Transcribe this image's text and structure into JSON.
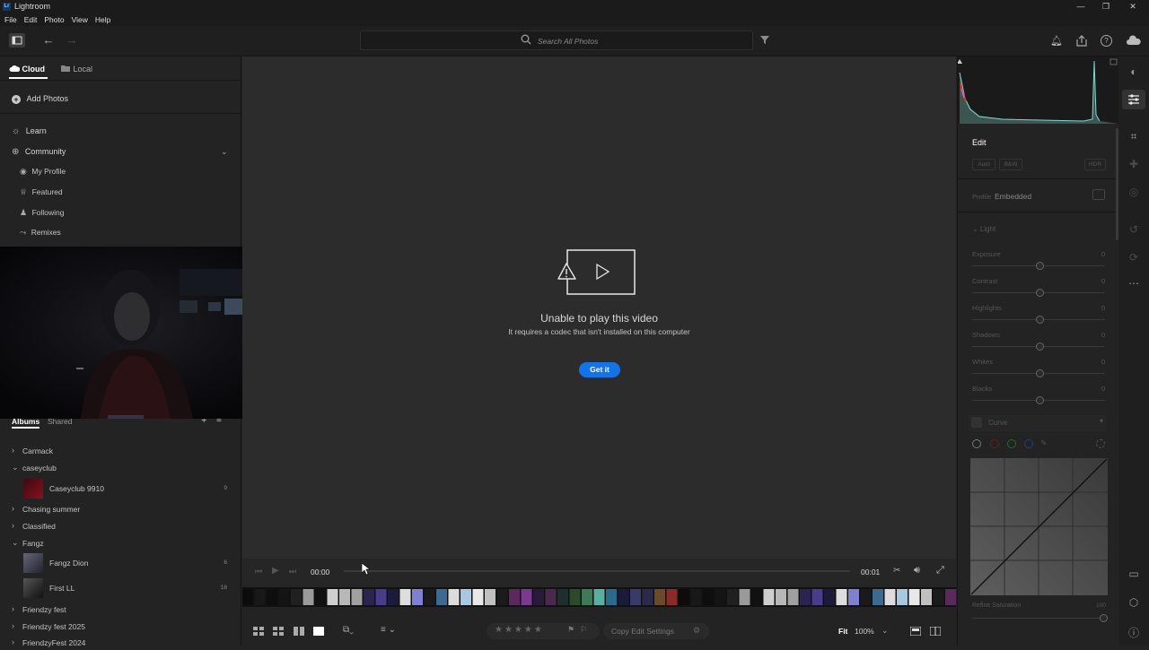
{
  "window": {
    "title": "Lightroom",
    "icon_text": "Lr",
    "min": "—",
    "max": "❐",
    "close": "✕"
  },
  "menu": [
    "File",
    "Edit",
    "Photo",
    "View",
    "Help"
  ],
  "search": {
    "placeholder": "Search All Photos"
  },
  "left": {
    "tabs": {
      "cloud": "Cloud",
      "local": "Local"
    },
    "add_photos": "Add Photos",
    "learn": "Learn",
    "community": "Community",
    "community_items": [
      "My Profile",
      "Featured",
      "Following",
      "Remixes"
    ],
    "albums_tab": "Albums",
    "shared_tab": "Shared",
    "albums": [
      {
        "name": "Carmack",
        "type": "folder",
        "state": "collapsed"
      },
      {
        "name": "caseyclub",
        "type": "folder",
        "state": "expanded"
      },
      {
        "name": "Caseyclub 9910",
        "type": "album",
        "count": "9"
      },
      {
        "name": "Chasing summer",
        "type": "folder",
        "state": "collapsed"
      },
      {
        "name": "Classified",
        "type": "folder",
        "state": "collapsed"
      },
      {
        "name": "Fangz",
        "type": "folder",
        "state": "expanded"
      },
      {
        "name": "Fangz Dion",
        "type": "album",
        "count": "6"
      },
      {
        "name": "First LL",
        "type": "album",
        "count": "18"
      },
      {
        "name": "Friendzy fest",
        "type": "folder",
        "state": "collapsed"
      },
      {
        "name": "Friendzy fest 2025",
        "type": "folder",
        "state": "collapsed"
      },
      {
        "name": "FriendzyFest 2024",
        "type": "folder",
        "state": "collapsed"
      }
    ]
  },
  "video": {
    "error_title": "Unable to play this video",
    "error_sub": "It requires a codec that isn't installed on this computer",
    "get_it": "Get it",
    "time_current": "00:00",
    "time_end": "00:01"
  },
  "bottom": {
    "copy_edit": "Copy Edit Settings",
    "fit": "Fit",
    "zoom": "100%"
  },
  "edit": {
    "title": "Edit",
    "buttons": [
      "Auto",
      "B&W",
      "HDR"
    ],
    "profile_label": "Profile",
    "profile_value": "Embedded",
    "light_section": "Light",
    "sliders": [
      {
        "name": "Exposure",
        "value": "0"
      },
      {
        "name": "Contrast",
        "value": "0"
      },
      {
        "name": "Highlights",
        "value": "0"
      },
      {
        "name": "Shadows",
        "value": "0"
      },
      {
        "name": "Whites",
        "value": "0"
      },
      {
        "name": "Blacks",
        "value": "0"
      }
    ],
    "curve_title": "Curve",
    "refine_label": "Refine Saturation",
    "refine_value": "100"
  },
  "colors": {
    "accent": "#1473e6",
    "bg": "#232323",
    "viewer": "#2c2c2c"
  }
}
